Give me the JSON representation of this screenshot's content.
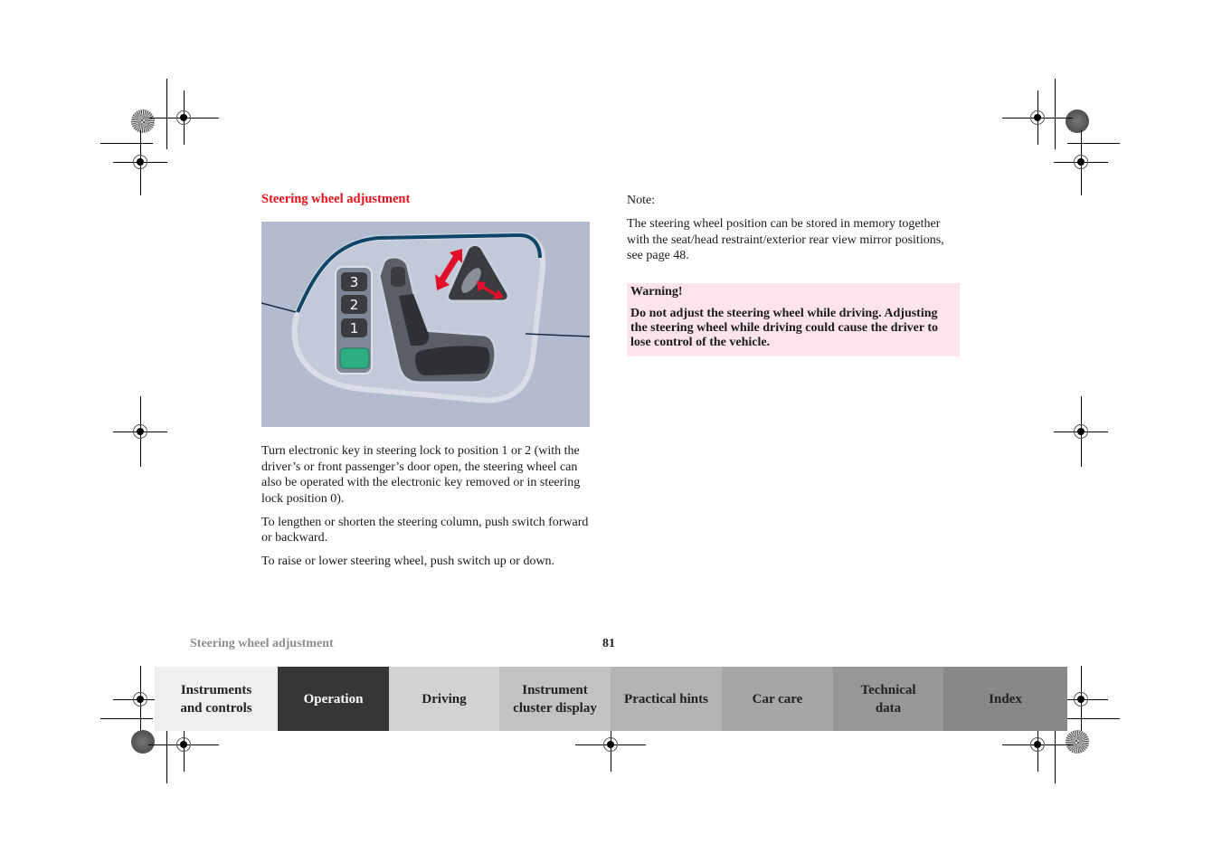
{
  "section": {
    "heading": "Steering wheel adjustment"
  },
  "figure": {
    "memory_buttons": [
      "3",
      "2",
      "1"
    ],
    "description": "Seat and steering wheel memory control panel with arrows"
  },
  "body_left": {
    "paragraphs": [
      "Turn electronic key in steering lock to position 1 or 2 (with the driver’s or front passenger’s door open, the steering wheel can also be operated with the electronic key removed or in steering lock position 0).",
      "To lengthen or shorten the steering column, push switch forward or backward.",
      "To raise or lower steering wheel, push switch up or down."
    ]
  },
  "body_right": {
    "note_label": "Note:",
    "note_text": "The steering wheel position can be stored in memory together with the seat/head restraint/exterior rear view mirror positions, see page 48.",
    "warning": {
      "title": "Warning!",
      "text": "Do not adjust the steering wheel while driving. Adjusting the steering wheel while driving could cause the driver to lose control of the vehicle."
    }
  },
  "footer": {
    "title": "Steering wheel adjustment",
    "page_number": "81"
  },
  "nav": {
    "tabs": [
      {
        "label": "Instruments\nand controls",
        "bg": "#efefef",
        "color": "#222222",
        "active": false
      },
      {
        "label": "Operation",
        "bg": "#363636",
        "color": "#ffffff",
        "active": true
      },
      {
        "label": "Driving",
        "bg": "#d2d2d2",
        "color": "#222222",
        "active": false
      },
      {
        "label": "Instrument\ncluster display",
        "bg": "#c2c2c2",
        "color": "#222222",
        "active": false
      },
      {
        "label": "Practical hints",
        "bg": "#b4b4b4",
        "color": "#222222",
        "active": false
      },
      {
        "label": "Car care",
        "bg": "#a6a6a6",
        "color": "#222222",
        "active": false
      },
      {
        "label": "Technical\ndata",
        "bg": "#979797",
        "color": "#222222",
        "active": false
      },
      {
        "label": "Index",
        "bg": "#888888",
        "color": "#222222",
        "active": false
      }
    ]
  },
  "colors": {
    "heading": "#e8111d",
    "warning_bg": "#fde4ea",
    "figure_bg": "#b3bccf",
    "memory_set_button": "#2fae84",
    "arrow": "#e0102a"
  }
}
